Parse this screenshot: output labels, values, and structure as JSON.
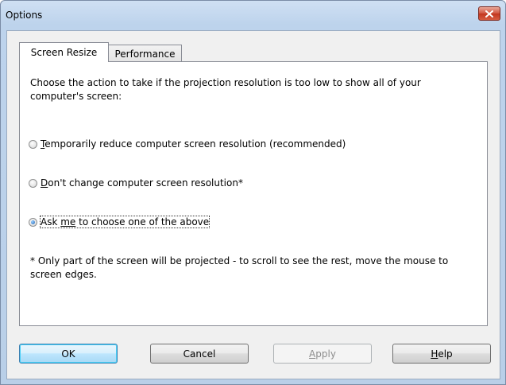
{
  "window": {
    "title": "Options"
  },
  "tabs": [
    {
      "label": "Screen Resize",
      "active": true
    },
    {
      "label": "Performance",
      "active": false
    }
  ],
  "panel": {
    "prompt": "Choose the action to take if the projection resolution is too low to show all of your computer's screen:",
    "options": [
      {
        "mnemonic": "T",
        "rest": "emporarily reduce computer screen resolution (recommended)",
        "checked": false
      },
      {
        "mnemonic": "D",
        "rest": "on't change computer screen resolution*",
        "checked": false
      },
      {
        "pre": "Ask ",
        "mnemonic": "me",
        "rest": " to choose one of the above",
        "checked": true
      }
    ],
    "note": "* Only part of the screen will be projected - to scroll to see the rest, move the mouse to screen edges."
  },
  "buttons": {
    "ok": "OK",
    "cancel": "Cancel",
    "apply_mnemonic": "A",
    "apply_rest": "pply",
    "help_mnemonic": "H",
    "help_rest": "elp"
  },
  "colors": {
    "title_bar": "#bdd3ec",
    "close_button": "#c2361f",
    "default_button": "#3c7fb1"
  }
}
